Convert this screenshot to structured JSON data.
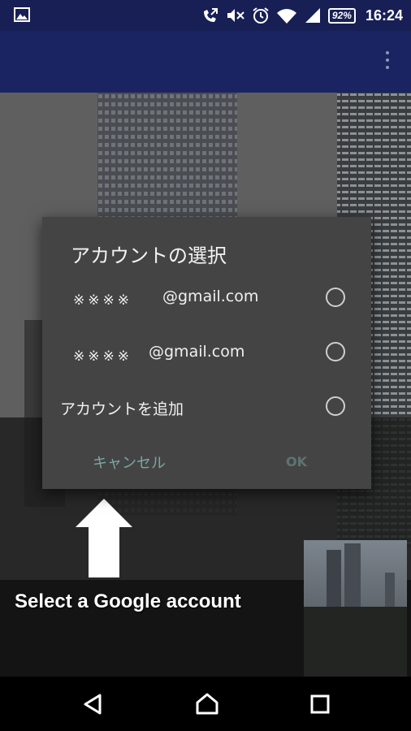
{
  "status_bar": {
    "battery": "92%",
    "time": "16:24"
  },
  "dialog": {
    "title": "アカウントの選択",
    "accounts": [
      {
        "mask": "※※※※",
        "domain": "@gmail.com"
      },
      {
        "mask": "※※※※",
        "domain": "@gmail.com"
      }
    ],
    "add_account": "アカウントを追加",
    "cancel_label": "キャンセル",
    "ok_label": "OK"
  },
  "caption": "Select a Google account",
  "colors": {
    "toolbar": "#1b2462",
    "dialog_bg": "#444444",
    "button_accent": "#7aa7a3"
  }
}
